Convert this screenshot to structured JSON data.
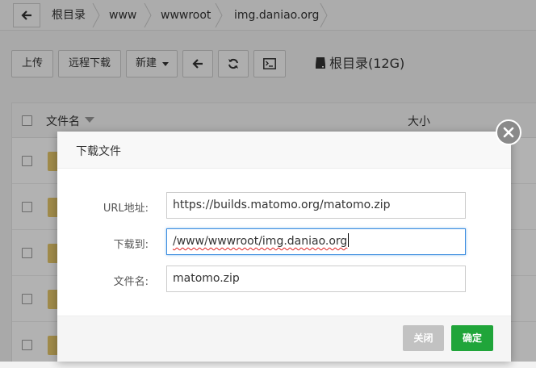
{
  "breadcrumb": {
    "back_icon": "arrow-left-icon",
    "items": [
      "根目录",
      "www",
      "wwwroot",
      "img.daniao.org"
    ]
  },
  "toolbar": {
    "upload_label": "上传",
    "remote_download_label": "远程下载",
    "new_label": "新建",
    "back_icon": "arrow-left-icon",
    "refresh_icon": "refresh-icon",
    "terminal_icon": "terminal-icon",
    "disk_icon": "hard-drive-icon",
    "disk_label": "根目录(12G)"
  },
  "table": {
    "columns": [
      "文件名",
      "大小"
    ],
    "sort_icon": "caret-down-icon",
    "folder_icon": "folder-icon"
  },
  "modal": {
    "title": "下载文件",
    "fields": [
      {
        "label": "URL地址:",
        "value": "https://builds.matomo.org/matomo.zip"
      },
      {
        "label": "下载到:",
        "value": "/www/wwwroot/img.daniao.org"
      },
      {
        "label": "文件名:",
        "value": "matomo.zip"
      }
    ],
    "close_label": "关闭",
    "confirm_label": "确定",
    "close_icon": "close-icon"
  },
  "colors": {
    "confirm": "#20a53a",
    "close_disabled": "#c2c2c2",
    "focus_border": "#3b8de0",
    "folder": "#e6c76b"
  }
}
